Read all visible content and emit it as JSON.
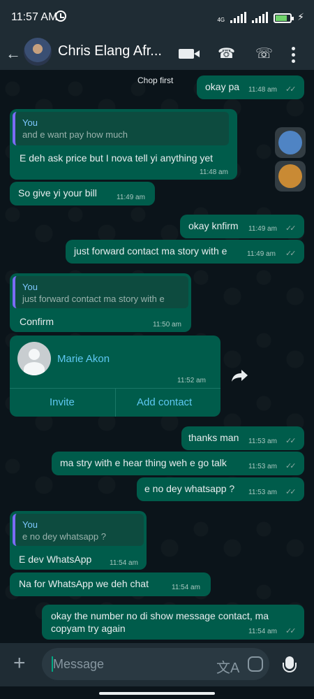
{
  "status_bar": {
    "time": "11:57 AM",
    "network": "4G",
    "battery_level": 0.7,
    "icons": [
      "alarm-icon",
      "signal-icon",
      "battery-icon",
      "charging-icon"
    ]
  },
  "header": {
    "back_icon": "back-arrow-icon",
    "contact_name": "Chris Elang Afr...",
    "actions": [
      "video-call-icon",
      "phone-icon",
      "call-plus-icon",
      "more-vert-icon"
    ]
  },
  "chat": {
    "top_preview": "Chop first",
    "messages": [
      {
        "type": "outgoing",
        "text": "okay pa",
        "time": "11:48 am"
      },
      {
        "type": "incoming",
        "quote_author": "You",
        "quote_text": "and e want pay how much",
        "text": "E deh ask price but I nova tell yi anything yet",
        "time": "11:48 am"
      },
      {
        "type": "incoming",
        "text": "So give yi your bill",
        "time": "11:49 am"
      },
      {
        "type": "outgoing",
        "text": "okay knfirm",
        "time": "11:49 am"
      },
      {
        "type": "outgoing",
        "text": "just forward contact ma story with e",
        "time": "11:49 am"
      },
      {
        "type": "incoming",
        "quote_author": "You",
        "quote_text": "just forward contact ma story with e",
        "text": "Confirm",
        "time": "11:50 am"
      },
      {
        "type": "contact",
        "contact_name": "Marie Akon",
        "time": "11:52 am",
        "actions": [
          "Invite",
          "Add contact"
        ]
      },
      {
        "type": "outgoing",
        "text": "thanks man",
        "time": "11:53 am"
      },
      {
        "type": "outgoing",
        "text": "ma stry with e hear thing weh e go talk",
        "time": "11:53 am"
      },
      {
        "type": "outgoing",
        "text": "e no dey whatsapp ?",
        "time": "11:53 am"
      },
      {
        "type": "incoming",
        "quote_author": "You",
        "quote_text": "e no dey whatsapp ?",
        "text": "E dev WhatsApp",
        "time": "11:54 am"
      },
      {
        "type": "incoming",
        "text": "Na for WhatsApp we deh chat",
        "time": "11:54 am"
      },
      {
        "type": "outgoing",
        "text": "okay the number no di show message contact, ma copyam try again",
        "time": "11:54 am"
      }
    ]
  },
  "composer": {
    "placeholder": "Message",
    "icons": [
      "plus-icon",
      "translate-icon",
      "sticker-icon",
      "mic-icon"
    ]
  },
  "colors": {
    "background": "#0b141a",
    "bar": "#1f2c34",
    "bubble": "#005c4b",
    "accent": "#00a884",
    "link": "#5ec8f2",
    "quote_bar": "#7b6bf6"
  }
}
